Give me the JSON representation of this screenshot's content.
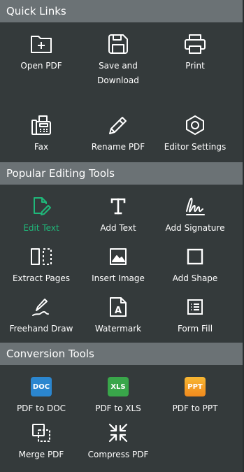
{
  "sections": {
    "quick_links": {
      "title": "Quick Links",
      "items": [
        {
          "label": "Open PDF",
          "icon": "folder-plus-icon"
        },
        {
          "label": "Save and\nDownload",
          "icon": "floppy-disk-icon"
        },
        {
          "label": "Print",
          "icon": "printer-icon"
        },
        {
          "label": "Fax",
          "icon": "fax-icon"
        },
        {
          "label": "Rename PDF",
          "icon": "pencil-icon"
        },
        {
          "label": "Editor Settings",
          "icon": "hexagon-settings-icon"
        }
      ]
    },
    "popular": {
      "title": "Popular Editing Tools",
      "items": [
        {
          "label": "Edit Text",
          "icon": "edit-document-icon",
          "active": true
        },
        {
          "label": "Add Text",
          "icon": "text-t-icon"
        },
        {
          "label": "Add Signature",
          "icon": "signature-icon"
        },
        {
          "label": "Extract Pages",
          "icon": "extract-pages-icon"
        },
        {
          "label": "Insert Image",
          "icon": "image-icon"
        },
        {
          "label": "Add Shape",
          "icon": "square-icon"
        },
        {
          "label": "Freehand Draw",
          "icon": "pen-draw-icon"
        },
        {
          "label": "Watermark",
          "icon": "watermark-icon"
        },
        {
          "label": "Form Fill",
          "icon": "form-list-icon"
        }
      ]
    },
    "conversion": {
      "title": "Conversion Tools",
      "items": [
        {
          "label": "PDF to DOC",
          "icon": "doc-badge-icon",
          "badge": "DOC"
        },
        {
          "label": "PDF to XLS",
          "icon": "xls-badge-icon",
          "badge": "XLS"
        },
        {
          "label": "PDF to PPT",
          "icon": "ppt-badge-icon",
          "badge": "PPT"
        },
        {
          "label": "Merge PDF",
          "icon": "merge-icon"
        },
        {
          "label": "Compress PDF",
          "icon": "compress-icon"
        }
      ]
    }
  },
  "colors": {
    "background": "#343a3b",
    "header": "#6b7275",
    "accent": "#1fb87a",
    "doc": "#2b86cf",
    "xls": "#39a64a",
    "ppt_top": "#f7b733",
    "ppt_bottom": "#f18a1e"
  }
}
